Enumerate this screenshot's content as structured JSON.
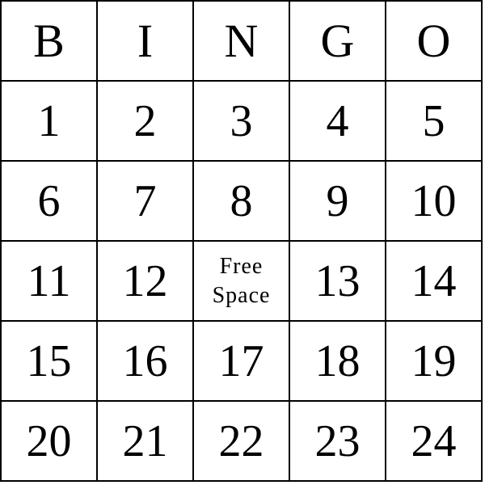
{
  "header": [
    "B",
    "I",
    "N",
    "G",
    "O"
  ],
  "rows": [
    [
      "1",
      "2",
      "3",
      "4",
      "5"
    ],
    [
      "6",
      "7",
      "8",
      "9",
      "10"
    ],
    [
      "11",
      "12",
      "FREE",
      "13",
      "14"
    ],
    [
      "15",
      "16",
      "17",
      "18",
      "19"
    ],
    [
      "20",
      "21",
      "22",
      "23",
      "24"
    ]
  ],
  "free_space": {
    "line1": "Free",
    "line2": "Space"
  }
}
